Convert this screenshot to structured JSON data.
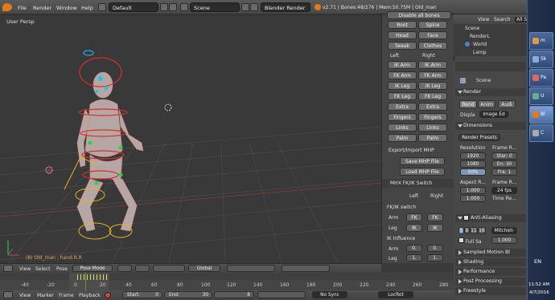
{
  "menu": {
    "file": "File",
    "render": "Render",
    "window": "Window",
    "help": "Help",
    "layout": "Default",
    "scene": "Scene",
    "engine": "Blender Render",
    "info": "v2.71 | Bones:48/276 | Mem:50.75M | Old_man"
  },
  "viewport": {
    "label": "User Persp",
    "object_label": "(8) Old_man : hand.R.R"
  },
  "npanel": {
    "top_cut": "Disable all bones",
    "rows": [
      [
        "Root",
        "Spine"
      ],
      [
        "Head",
        "Face"
      ],
      [
        "Tweak",
        "Clothes"
      ]
    ],
    "left": "Left",
    "right": "Right",
    "limbs": [
      [
        "IK Arm",
        "IK Arm"
      ],
      [
        "FK Arm",
        "FK Arm"
      ],
      [
        "IK Leg",
        "IK Leg"
      ],
      [
        "FK Leg",
        "FK Leg"
      ],
      [
        "Extra",
        "Extra"
      ],
      [
        "Fingers",
        "Fingers"
      ],
      [
        "Links",
        "Links"
      ],
      [
        "Palm",
        "Palm"
      ]
    ],
    "export_title": "Export/Import MHP",
    "save": "Save MHP File",
    "load": "Load MHP File",
    "switch_title": "MHX FK/IK Switch",
    "sw_left": "Left",
    "sw_right": "Right",
    "fkik": "FK/IK switch",
    "arm": "Arm",
    "leg": "Leg",
    "fk": "FK",
    "ik": "IK",
    "influence": "IK Influence",
    "inf_arm": "Arm",
    "inf_leg": "Leg",
    "inf_val": "0.",
    "inf_val2": "1."
  },
  "outliner": {
    "view": "View",
    "search": "Search",
    "all": "All S",
    "items": [
      "Scene",
      "RenderL",
      "World",
      "Lamp"
    ]
  },
  "props": {
    "scene": "Scene",
    "render": "Render",
    "render_btn": "Rend",
    "anim": "Anim",
    "audio": "Audi",
    "display": "Displa",
    "display_val": "Image Ed",
    "dimensions": "Dimensions",
    "presets": "Render Presets",
    "resolution": "Resolution",
    "frame_r": "Frame R...",
    "resx": "1920",
    "resy": "1080",
    "pct": "50%",
    "start": "Star: 0",
    "end": "En: 30",
    "frame": "Fra: 1",
    "aspect": "Aspect R...",
    "frame_rate": "Frame R...",
    "ax": "1.000",
    "ay": "1.000",
    "fps": "24 fps",
    "time_r": "Time Re...",
    "aa": "Anti-Aliasing",
    "aa5": "5",
    "aa8": "8",
    "aa11": "11",
    "aa16": "16",
    "filter": "Mitchell-",
    "full": "Full Sa",
    "fullval": "1.000",
    "sections": [
      "Sampled Motion Bl",
      "Shading",
      "Performance",
      "Post Processing",
      "Freestyle"
    ]
  },
  "header3d": {
    "view": "View",
    "select": "Select",
    "pose": "Pose",
    "mode": "Pose Mode",
    "global": "Global"
  },
  "timeline": {
    "ticks": [
      "-40",
      "-20",
      "0",
      "20",
      "40",
      "60",
      "80",
      "100",
      "120",
      "140",
      "160",
      "180",
      "200",
      "220",
      "240",
      "260",
      "280"
    ],
    "view": "View",
    "marker": "Marker",
    "frame": "Frame",
    "playback": "Playback",
    "start": "Start:",
    "start_val": "0",
    "end": "End:",
    "end_val": "30",
    "cur": "8",
    "sync": "No Sync",
    "keying": "LocRot"
  },
  "taskbar": {
    "items": [
      "m",
      "Sk",
      "Pa",
      "U",
      "Bl",
      "C"
    ],
    "lang": "EN",
    "time": "11:52 AM",
    "date": "4/7/2016"
  }
}
